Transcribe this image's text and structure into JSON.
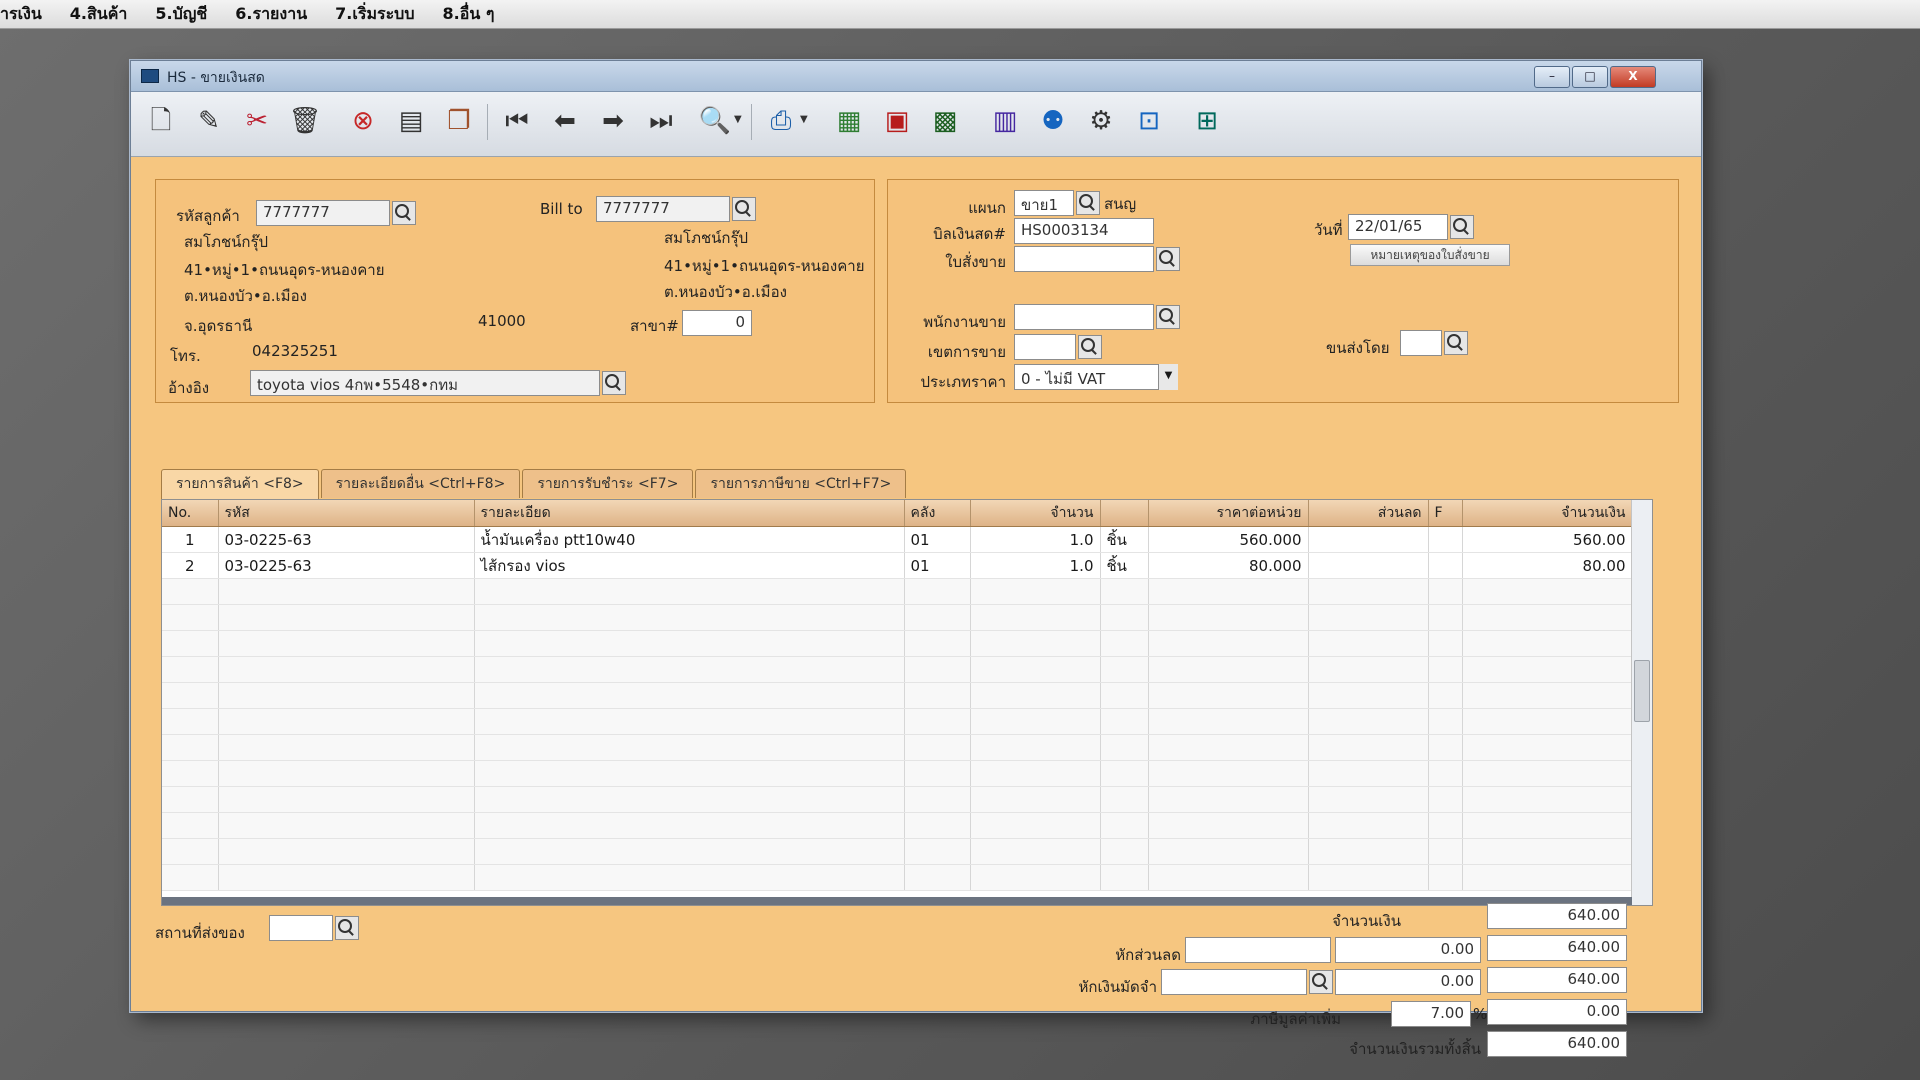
{
  "menu": [
    "ารเงิน",
    "4.สินค้า",
    "5.บัญชี",
    "6.รายงาน",
    "7.เริ่มระบบ",
    "8.อื่น ๆ"
  ],
  "window": {
    "title": "HS - ขายเงินสด",
    "min": "–",
    "max": "□",
    "close": "X"
  },
  "toolbar": {
    "icons": [
      "new-icon",
      "edit-icon",
      "delete-icon",
      "trash-icon",
      "cancel-icon",
      "save-icon",
      "copy-icon",
      "first-record-icon",
      "prev-record-icon",
      "next-record-icon",
      "last-record-icon",
      "search-icon",
      "print-icon",
      "export-icon",
      "calc-icon",
      "report-icon",
      "calendar-icon",
      "user-icon",
      "tools-icon",
      "ok-icon",
      "network-icon"
    ]
  },
  "customer": {
    "code_label": "รหัสลูกค้า",
    "code": "7777777",
    "bill_to_label": "Bill to",
    "bill_to": "7777777",
    "name": "สมโภชน์กรุ๊ป",
    "addr1": "41•หมู่•1•ถนนอุดร-หนองคาย",
    "addr2": "ต.หนองบัว•อ.เมือง",
    "province": "จ.อุดรธานี",
    "zip": "41000",
    "bill_name": "สมโภชน์กรุ๊ป",
    "bill_addr1": "41•หมู่•1•ถนนอุดร-หนองคาย",
    "bill_addr2": "ต.หนองบัว•อ.เมือง",
    "branch_label": "สาขา#",
    "branch": "0",
    "tel_label": "โทร.",
    "tel": "042325251",
    "ref_label": "อ้างอิง",
    "ref": "toyota vios 4กพ•5548•กทม"
  },
  "doc": {
    "dept_label": "แผนก",
    "dept": "ขาย1",
    "dept_name": "สนญ",
    "bill_no_label": "บิลเงินสด#",
    "bill_no": "HS0003134",
    "date_label": "วันที่",
    "date": "22/01/65",
    "order_label": "ใบสั่งขาย",
    "order": "",
    "order_note_btn": "หมายเหตุของใบสั่งขาย",
    "salesman_label": "พนักงานขาย",
    "salesman": "",
    "area_label": "เขตการขาย",
    "area": "",
    "ship_by_label": "ขนส่งโดย",
    "ship_by": "",
    "price_type_label": "ประเภทราคา",
    "price_type": "0 - ไม่มี VAT"
  },
  "tabs": [
    "รายการสินค้า <F8>",
    "รายละเอียดอื่น <Ctrl+F8>",
    "รายการรับชำระ <F7>",
    "รายการภาษีขาย <Ctrl+F7>"
  ],
  "grid": {
    "headers": [
      "No.",
      "รหัส",
      "รายละเอียด",
      "คลัง",
      "จำนวน",
      "",
      "ราคาต่อหน่วย",
      "ส่วนลด",
      "F",
      "จำนวนเงิน"
    ],
    "rows": [
      {
        "no": "1",
        "code": "03-0225-63",
        "desc": "น้ำมันเครื่อง ptt10w40",
        "wh": "01",
        "qty": "1.0",
        "unit": "ชิ้น",
        "price": "560.000",
        "disc": "",
        "f": "",
        "amount": "560.00"
      },
      {
        "no": "2",
        "code": "03-0225-63",
        "desc": "ไส้กรอง vios",
        "wh": "01",
        "qty": "1.0",
        "unit": "ชิ้น",
        "price": "80.000",
        "disc": "",
        "f": "",
        "amount": "80.00"
      }
    ]
  },
  "footer": {
    "ship_place_label": "สถานที่ส่งของ",
    "ship_place": "",
    "amount_label": "จำนวนเงิน",
    "amount": "640.00",
    "discount_label": "หักส่วนลด",
    "discount_text": "",
    "discount_value": "0.00",
    "after_discount": "640.00",
    "deposit_label": "หักเงินมัดจำ",
    "deposit_text": "",
    "deposit_value": "0.00",
    "after_deposit": "640.00",
    "vat_label": "ภาษีมูลค่าเพิ่ม",
    "vat_rate": "7.00",
    "vat_pct": "%",
    "vat_amount": "0.00",
    "total_label": "จำนวนเงินรวมทั้งสิ้น",
    "total": "640.00"
  }
}
